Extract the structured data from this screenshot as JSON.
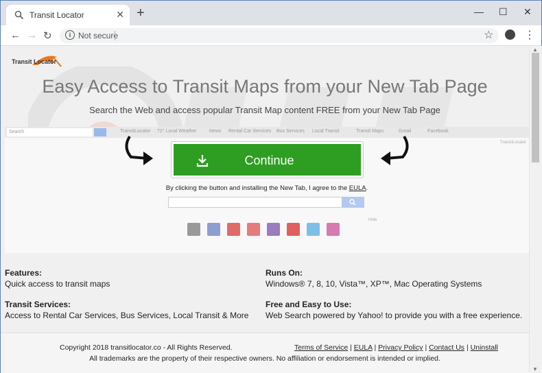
{
  "browser": {
    "tab_title": "Transit Locator",
    "new_tab": "+",
    "minimize": "—",
    "maximize": "☐",
    "close": "✕",
    "tab_close": "✕",
    "back": "←",
    "forward": "→",
    "reload": "↻",
    "address_status": "Not secure",
    "star": "☆",
    "menu": "⋮"
  },
  "page": {
    "logo_text": "Transit Locator",
    "headline": "Easy Access to Transit Maps from your New Tab Page",
    "subheadline": "Search the Web and access popular Transit Map content FREE from your New Tab Page",
    "continue_label": "Continue",
    "agree_text": "By clicking the button and installing the New Tab, I agree to the ",
    "eula_link": "EULA",
    "agree_end": ".",
    "fake_bar": {
      "search_placeholder": "Search",
      "items": [
        "TransitLocator",
        "72° Local Weather",
        "News",
        "Rental Car Services",
        "Bus Services",
        "Local Transit",
        "Transit Maps",
        "Gmail",
        "Facebook"
      ],
      "brand": "TransitLocator"
    },
    "hide_label": "Hide"
  },
  "features": {
    "features_head": "Features:",
    "features_text": "Quick access to transit maps",
    "services_head": "Transit Services:",
    "services_text": "Access to Rental Car Services, Bus Services, Local Transit & More",
    "runs_head": "Runs On:",
    "runs_text": "Windows® 7, 8, 10, Vista™, XP™, Mac Operating Systems",
    "free_head": "Free and Easy to Use:",
    "free_text": "Web Search powered by Yahoo! to provide you with a free experience."
  },
  "footer": {
    "copyright": "Copyright 2018 transitlocator.co - All Rights Reserved.",
    "links": [
      "Terms of Service",
      "EULA",
      "Privacy Policy",
      "Contact Us",
      "Uninstall"
    ],
    "legal": "All trademarks are the property of their respective owners. No affiliation or endorsement is intended or implied."
  },
  "colors": {
    "cta_green": "#2e9e22",
    "watermark": "#e3e3e3"
  }
}
